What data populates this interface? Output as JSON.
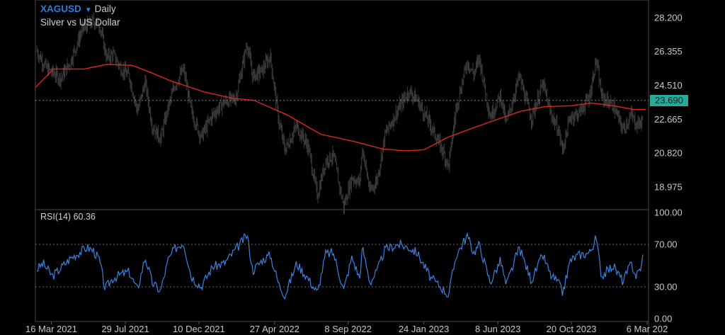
{
  "header": {
    "symbol": "XAGUSD",
    "timeframe": "Daily",
    "subtitle": "Silver vs US Dollar",
    "rsi_label": "RSI(14)",
    "rsi_value": "60.36",
    "last_price": "23.690"
  },
  "colors": {
    "background": "#000000",
    "candle": "#3a3a3a",
    "moving_average": "#e0261d",
    "rsi_line": "#3b82e0",
    "last_price_line": "#2aa89a",
    "symbol": "#2f7dd6"
  },
  "icons": {
    "symbol_dropdown": "triangle-down-icon"
  },
  "chart_data": [
    {
      "type": "candlestick",
      "title": "XAGUSD Daily",
      "subtitle": "Silver vs US Dollar",
      "ylim": [
        17.9,
        29.0
      ],
      "y_ticks": [
        "28.200",
        "26.355",
        "24.510",
        "22.665",
        "20.820",
        "18.975"
      ],
      "x_ticks": [
        "16 Mar 2021",
        "29 Jul 2021",
        "10 Dec 2021",
        "27 Apr 2022",
        "8 Sep 2022",
        "24 Jan 2023",
        "8 Jun 2023",
        "20 Oct 2023",
        "6 Mar 202"
      ],
      "last_price": 23.69,
      "close_series": [
        [
          "2021-02-15",
          26.5
        ],
        [
          "2021-03-08",
          25.4
        ],
        [
          "2021-04-02",
          24.9
        ],
        [
          "2021-04-20",
          25.8
        ],
        [
          "2021-05-12",
          27.6
        ],
        [
          "2021-06-01",
          28.0
        ],
        [
          "2021-06-12",
          27.8
        ],
        [
          "2021-06-25",
          26.0
        ],
        [
          "2021-07-06",
          26.2
        ],
        [
          "2021-07-22",
          25.4
        ],
        [
          "2021-08-05",
          25.0
        ],
        [
          "2021-08-20",
          23.1
        ],
        [
          "2021-09-03",
          24.7
        ],
        [
          "2021-09-16",
          22.3
        ],
        [
          "2021-10-01",
          21.6
        ],
        [
          "2021-10-15",
          23.3
        ],
        [
          "2021-10-27",
          24.5
        ],
        [
          "2021-11-12",
          25.4
        ],
        [
          "2021-11-26",
          23.1
        ],
        [
          "2021-12-14",
          21.7
        ],
        [
          "2022-01-04",
          22.9
        ],
        [
          "2022-01-25",
          23.6
        ],
        [
          "2022-02-15",
          23.8
        ],
        [
          "2022-03-08",
          26.8
        ],
        [
          "2022-03-18",
          25.0
        ],
        [
          "2022-04-04",
          25.3
        ],
        [
          "2022-04-19",
          26.1
        ],
        [
          "2022-05-05",
          22.5
        ],
        [
          "2022-05-16",
          21.0
        ],
        [
          "2022-06-06",
          22.3
        ],
        [
          "2022-06-27",
          21.2
        ],
        [
          "2022-07-14",
          18.5
        ],
        [
          "2022-07-29",
          20.4
        ],
        [
          "2022-08-12",
          20.7
        ],
        [
          "2022-08-31",
          17.9
        ],
        [
          "2022-09-15",
          19.5
        ],
        [
          "2022-09-29",
          19.2
        ],
        [
          "2022-10-04",
          21.1
        ],
        [
          "2022-10-18",
          18.7
        ],
        [
          "2022-10-31",
          19.4
        ],
        [
          "2022-11-14",
          21.8
        ],
        [
          "2022-12-08",
          23.2
        ],
        [
          "2022-12-28",
          24.2
        ],
        [
          "2023-01-12",
          23.7
        ],
        [
          "2023-02-06",
          22.3
        ],
        [
          "2023-02-28",
          20.9
        ],
        [
          "2023-03-10",
          20.1
        ],
        [
          "2023-03-24",
          23.3
        ],
        [
          "2023-04-13",
          25.8
        ],
        [
          "2023-04-25",
          25.1
        ],
        [
          "2023-05-05",
          26.0
        ],
        [
          "2023-05-25",
          22.8
        ],
        [
          "2023-06-13",
          24.0
        ],
        [
          "2023-06-23",
          22.4
        ],
        [
          "2023-07-17",
          25.0
        ],
        [
          "2023-08-08",
          22.7
        ],
        [
          "2023-08-29",
          24.6
        ],
        [
          "2023-09-12",
          23.0
        ],
        [
          "2023-09-26",
          22.1
        ],
        [
          "2023-10-04",
          21.0
        ],
        [
          "2023-10-18",
          22.8
        ],
        [
          "2023-11-03",
          23.0
        ],
        [
          "2023-11-22",
          23.9
        ],
        [
          "2023-12-04",
          25.9
        ],
        [
          "2023-12-14",
          23.9
        ],
        [
          "2024-01-04",
          23.4
        ],
        [
          "2024-01-22",
          22.1
        ],
        [
          "2024-02-06",
          22.9
        ],
        [
          "2024-02-15",
          22.4
        ],
        [
          "2024-02-26",
          22.5
        ],
        [
          "2024-03-04",
          23.69
        ]
      ],
      "moving_average_series": [
        [
          "2021-02-15",
          24.4
        ],
        [
          "2021-03-20",
          25.4
        ],
        [
          "2021-05-15",
          25.4
        ],
        [
          "2021-06-25",
          25.65
        ],
        [
          "2021-08-10",
          25.6
        ],
        [
          "2021-09-10",
          25.25
        ],
        [
          "2021-10-20",
          24.75
        ],
        [
          "2021-12-20",
          24.15
        ],
        [
          "2022-02-10",
          23.8
        ],
        [
          "2022-03-20",
          23.7
        ],
        [
          "2022-05-20",
          22.9
        ],
        [
          "2022-07-20",
          21.85
        ],
        [
          "2022-09-20",
          21.45
        ],
        [
          "2022-11-10",
          21.05
        ],
        [
          "2022-12-20",
          20.95
        ],
        [
          "2023-01-24",
          21.0
        ],
        [
          "2023-03-10",
          21.7
        ],
        [
          "2023-04-20",
          22.15
        ],
        [
          "2023-06-01",
          22.6
        ],
        [
          "2023-07-20",
          23.1
        ],
        [
          "2023-09-01",
          23.35
        ],
        [
          "2023-10-20",
          23.4
        ],
        [
          "2023-11-25",
          23.55
        ],
        [
          "2024-01-05",
          23.4
        ],
        [
          "2024-02-10",
          23.2
        ],
        [
          "2024-03-04",
          23.2
        ]
      ]
    },
    {
      "type": "line",
      "title": "RSI(14) 60.36",
      "ylim": [
        0,
        100
      ],
      "y_ticks": [
        "100.00",
        "70.00",
        "30.00",
        "0.00"
      ],
      "reference_lines": [
        70,
        30
      ],
      "series": [
        {
          "name": "RSI(14)",
          "points": [
            [
              "2021-02-15",
              45
            ],
            [
              "2021-03-01",
              52
            ],
            [
              "2021-03-18",
              40
            ],
            [
              "2021-04-01",
              47
            ],
            [
              "2021-04-20",
              57
            ],
            [
              "2021-05-05",
              62
            ],
            [
              "2021-05-20",
              67
            ],
            [
              "2021-06-01",
              64
            ],
            [
              "2021-06-12",
              55
            ],
            [
              "2021-06-22",
              28
            ],
            [
              "2021-07-06",
              38
            ],
            [
              "2021-07-22",
              42
            ],
            [
              "2021-08-05",
              44
            ],
            [
              "2021-08-20",
              27
            ],
            [
              "2021-09-03",
              58
            ],
            [
              "2021-09-16",
              34
            ],
            [
              "2021-10-01",
              26
            ],
            [
              "2021-10-15",
              55
            ],
            [
              "2021-10-27",
              66
            ],
            [
              "2021-11-12",
              72
            ],
            [
              "2021-11-26",
              40
            ],
            [
              "2021-12-14",
              30
            ],
            [
              "2022-01-04",
              49
            ],
            [
              "2022-01-25",
              52
            ],
            [
              "2022-02-15",
              65
            ],
            [
              "2022-03-08",
              79
            ],
            [
              "2022-03-18",
              45
            ],
            [
              "2022-04-04",
              55
            ],
            [
              "2022-04-19",
              60
            ],
            [
              "2022-05-05",
              32
            ],
            [
              "2022-05-16",
              22
            ],
            [
              "2022-06-06",
              52
            ],
            [
              "2022-06-27",
              38
            ],
            [
              "2022-07-14",
              24
            ],
            [
              "2022-07-29",
              61
            ],
            [
              "2022-08-12",
              62
            ],
            [
              "2022-08-31",
              27
            ],
            [
              "2022-09-15",
              58
            ],
            [
              "2022-09-29",
              38
            ],
            [
              "2022-10-04",
              67
            ],
            [
              "2022-10-18",
              34
            ],
            [
              "2022-10-31",
              45
            ],
            [
              "2022-11-14",
              65
            ],
            [
              "2022-12-08",
              70
            ],
            [
              "2022-12-28",
              67
            ],
            [
              "2023-01-12",
              62
            ],
            [
              "2023-02-06",
              38
            ],
            [
              "2023-02-28",
              28
            ],
            [
              "2023-03-10",
              22
            ],
            [
              "2023-03-24",
              60
            ],
            [
              "2023-04-13",
              78
            ],
            [
              "2023-04-25",
              62
            ],
            [
              "2023-05-05",
              70
            ],
            [
              "2023-05-25",
              34
            ],
            [
              "2023-06-13",
              55
            ],
            [
              "2023-06-23",
              31
            ],
            [
              "2023-07-17",
              67
            ],
            [
              "2023-08-08",
              36
            ],
            [
              "2023-08-29",
              60
            ],
            [
              "2023-09-12",
              41
            ],
            [
              "2023-09-26",
              34
            ],
            [
              "2023-10-04",
              24
            ],
            [
              "2023-10-18",
              55
            ],
            [
              "2023-11-03",
              60
            ],
            [
              "2023-11-22",
              62
            ],
            [
              "2023-12-04",
              76
            ],
            [
              "2023-12-14",
              40
            ],
            [
              "2024-01-04",
              50
            ],
            [
              "2024-01-22",
              35
            ],
            [
              "2024-02-06",
              52
            ],
            [
              "2024-02-15",
              40
            ],
            [
              "2024-02-26",
              51
            ],
            [
              "2024-03-04",
              60.36
            ]
          ]
        }
      ]
    }
  ]
}
